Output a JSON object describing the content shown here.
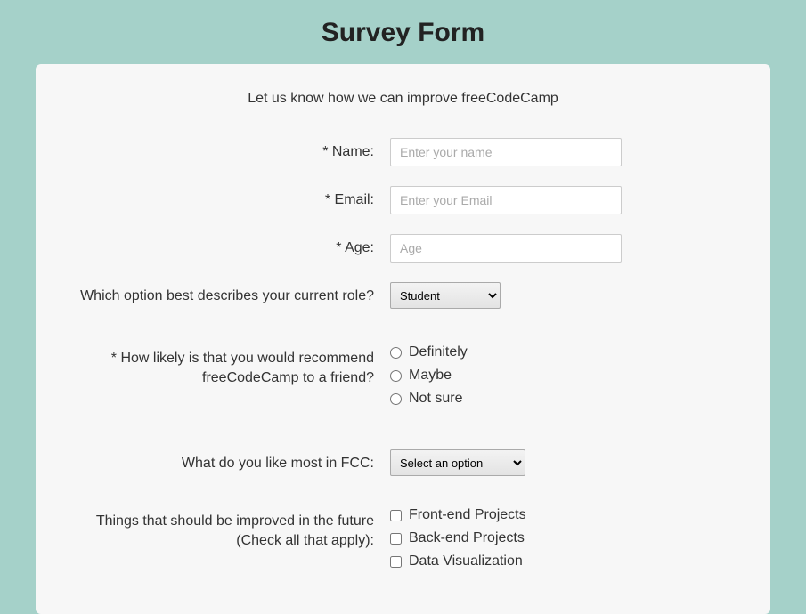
{
  "title": "Survey Form",
  "subtitle": "Let us know how we can improve freeCodeCamp",
  "fields": {
    "name": {
      "label": "* Name:",
      "placeholder": "Enter your name",
      "value": ""
    },
    "email": {
      "label": "* Email:",
      "placeholder": "Enter your Email",
      "value": ""
    },
    "age": {
      "label": "* Age:",
      "placeholder": "Age",
      "value": ""
    },
    "role": {
      "label": "Which option best describes your current role?",
      "selected": "Student"
    },
    "recommend": {
      "label": "* How likely is that you would recommend freeCodeCamp to a friend?",
      "options": [
        "Definitely",
        "Maybe",
        "Not sure"
      ]
    },
    "like": {
      "label": "What do you like most in FCC:",
      "selected": "Select an option"
    },
    "improve": {
      "label": "Things that should be improved in the future (Check all that apply):",
      "options": [
        "Front-end Projects",
        "Back-end Projects",
        "Data Visualization"
      ]
    }
  }
}
